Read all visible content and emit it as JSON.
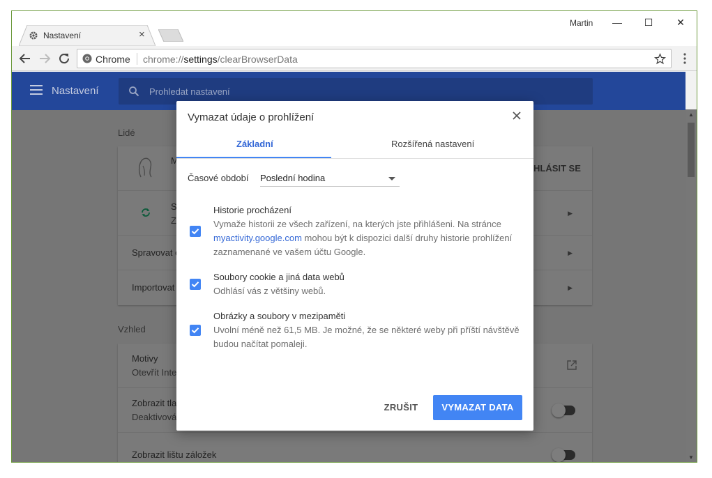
{
  "window": {
    "tab_title": "Nastavení",
    "user_name": "Martin",
    "controls": {
      "minimize": "—",
      "maximize": "☐",
      "close": "✕"
    }
  },
  "omnibox": {
    "site_label": "Chrome",
    "url_scheme": "chrome://",
    "url_host": "settings",
    "url_path": "/clearBrowserData"
  },
  "settings": {
    "header_title": "Nastavení",
    "search_placeholder": "Prohledat nastavení",
    "people_section": "Lidé",
    "people_rows": [
      {
        "title": "M",
        "action": "HLÁSIT SE"
      },
      {
        "title": "S",
        "subtitle": "Z"
      },
      {
        "title": "Spravovat o"
      },
      {
        "title": "Importovat"
      }
    ],
    "appearance_section": "Vzhled",
    "appearance_rows": [
      {
        "title": "Motivy",
        "subtitle": "Otevřít Inte"
      },
      {
        "title": "Zobrazit tla",
        "subtitle": "Deaktivová"
      },
      {
        "title": "Zobrazit lištu záložek"
      }
    ]
  },
  "dialog": {
    "title": "Vymazat údaje o prohlížení",
    "tabs": [
      {
        "label": "Základní",
        "selected": true
      },
      {
        "label": "Rozšířená nastavení",
        "selected": false
      }
    ],
    "time_range_label": "Časové období",
    "time_range_value": "Poslední hodina",
    "options": [
      {
        "checked": true,
        "title": "Historie procházení",
        "desc_before_link": "Vymaže historii ze všech zařízení, na kterých jste přihlášeni. Na stránce ",
        "link": "myactivity.google.com",
        "desc_after_link": " mohou být k dispozici další druhy historie prohlížení zaznamenané ve vašem účtu Google."
      },
      {
        "checked": true,
        "title": "Soubory cookie a jiná data webů",
        "desc": "Odhlásí vás z většiny webů."
      },
      {
        "checked": true,
        "title": "Obrázky a soubory v mezipaměti",
        "desc": "Uvolní méně než 61,5 MB. Je možné, že se některé weby při příští návštěvě budou načítat pomaleji."
      }
    ],
    "cancel_label": "ZRUŠIT",
    "confirm_label": "VYMAZAT DATA"
  },
  "colors": {
    "accent": "#4285f4",
    "header": "#23479a",
    "window_border": "#6d9a3e",
    "overlay_page": "#767676"
  }
}
